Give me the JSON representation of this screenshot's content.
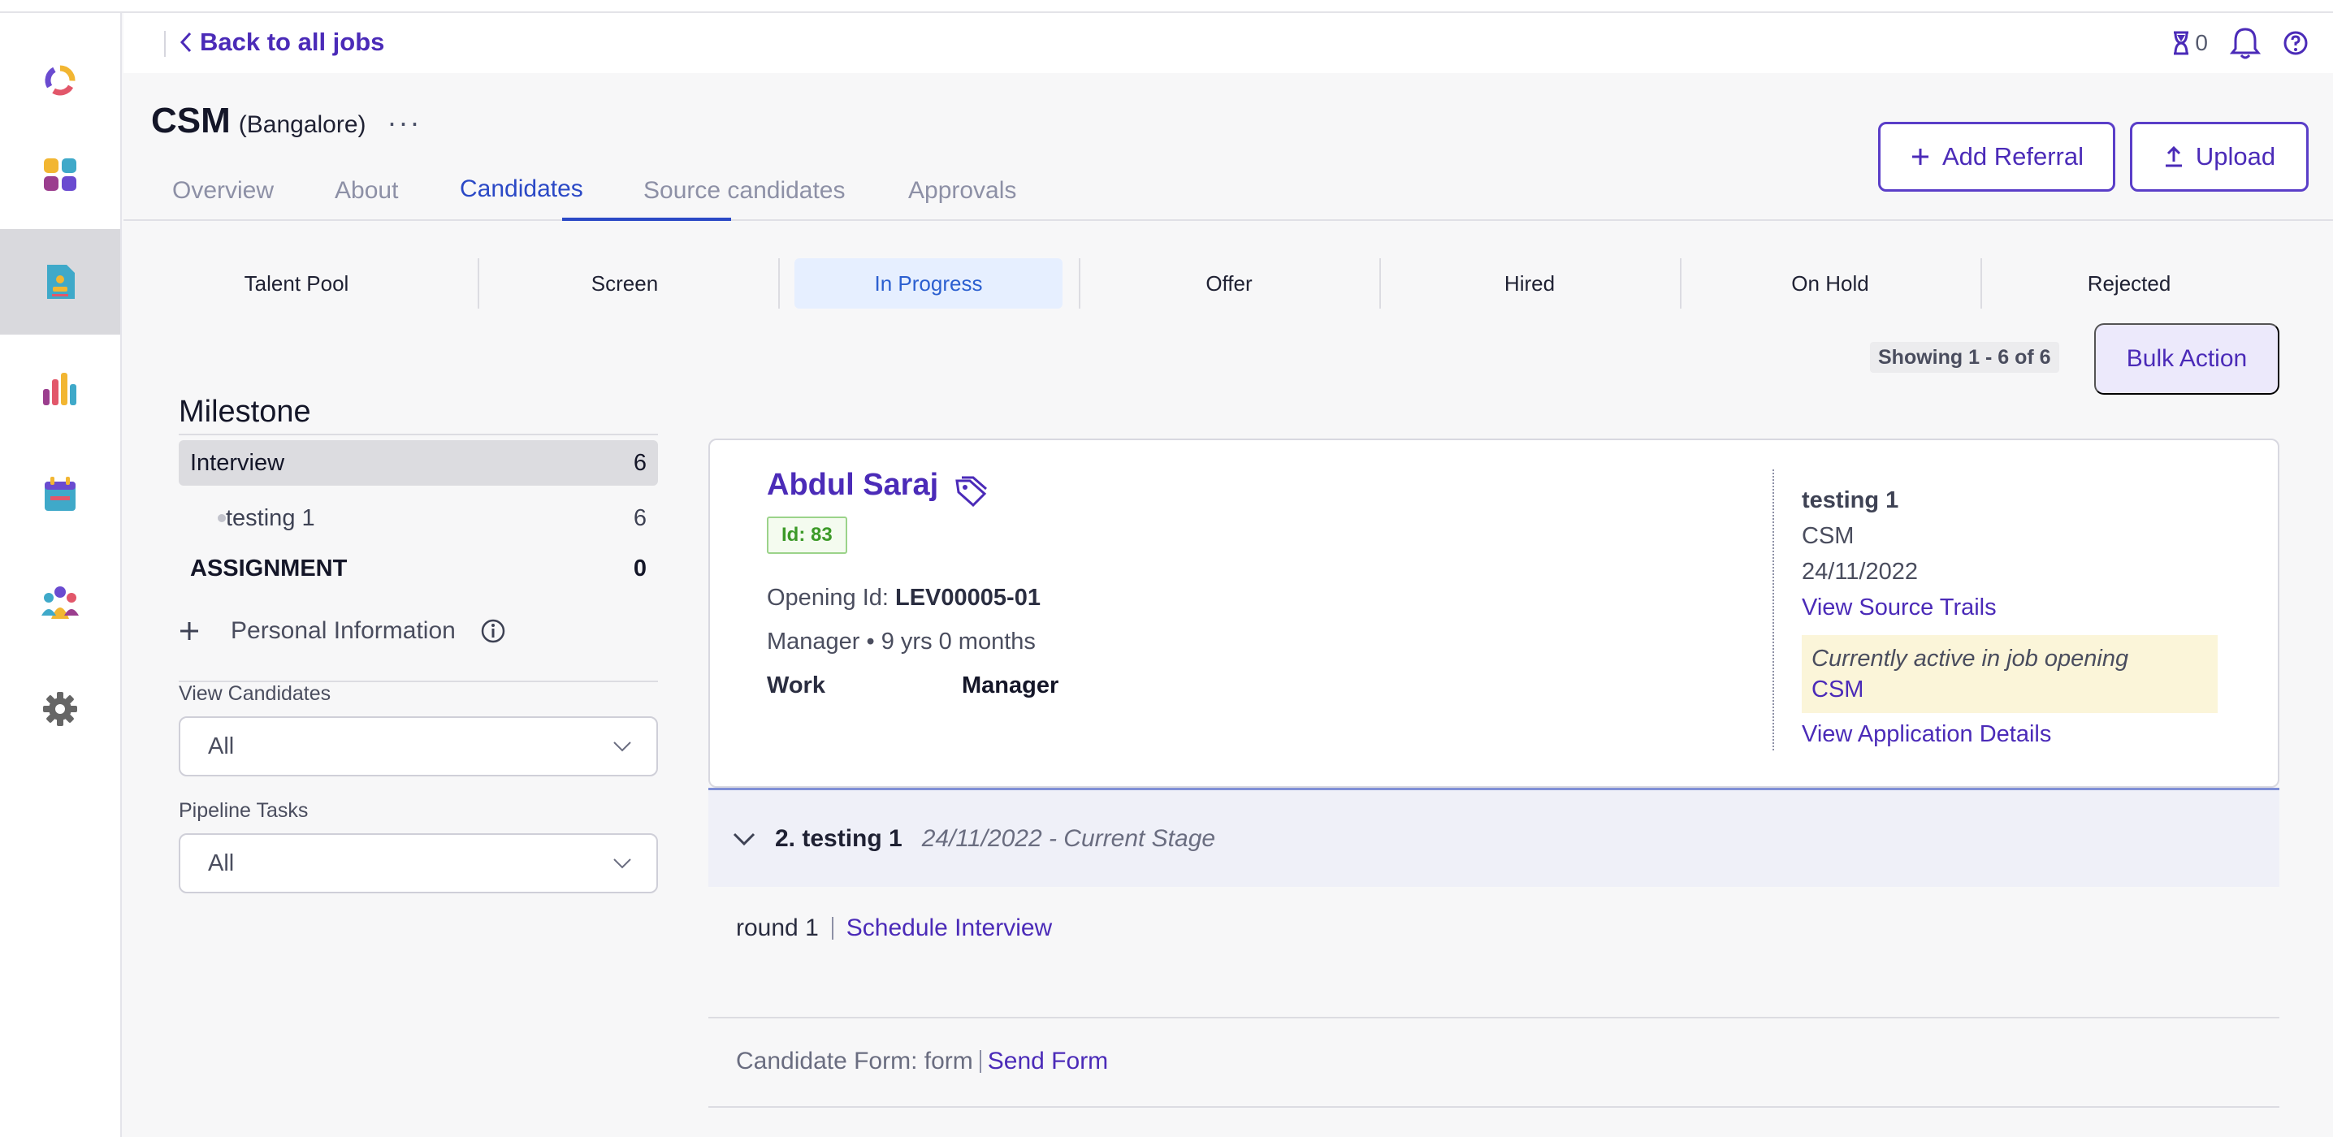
{
  "header": {
    "back_label": "Back to all jobs",
    "timer_count": "0"
  },
  "job": {
    "title": "CSM",
    "location": "(Bangalore)",
    "more": "···"
  },
  "tabs": [
    "Overview",
    "About",
    "Candidates",
    "Source candidates",
    "Approvals"
  ],
  "actions": {
    "add_referral": "Add Referral",
    "upload": "Upload",
    "bulk_action": "Bulk Action"
  },
  "stages": [
    "Talent Pool",
    "Screen",
    "In Progress",
    "Offer",
    "Hired",
    "On Hold",
    "Rejected"
  ],
  "active_stage": "In Progress",
  "showing": "Showing 1 - 6 of 6",
  "milestone": {
    "title": "Milestone",
    "rows": [
      {
        "label": "Interview",
        "count": "6"
      },
      {
        "label": "testing 1",
        "count": "6"
      },
      {
        "label": "ASSIGNMENT",
        "count": "0"
      }
    ]
  },
  "filters": {
    "personal_info": "Personal Information",
    "view_candidates_label": "View Candidates",
    "view_candidates_value": "All",
    "pipeline_tasks_label": "Pipeline Tasks",
    "pipeline_tasks_value": "All"
  },
  "candidate": {
    "name": "Abdul Saraj",
    "id": "Id: 83",
    "opening_label": "Opening Id: ",
    "opening_id": "LEV00005-01",
    "experience": "Manager • 9 yrs 0 months",
    "work_label": "Work",
    "work_value": "Manager",
    "stage_name": "testing 1",
    "job": "CSM",
    "date": "24/11/2022",
    "view_source_trails": "View Source Trails",
    "active_note": "Currently active in job opening",
    "active_job": "CSM",
    "view_application": "View Application Details"
  },
  "stage_detail": {
    "title": "2. testing 1",
    "date": "24/11/2022 - Current Stage",
    "round": "round 1",
    "schedule": "Schedule Interview",
    "form_label": "Candidate Form: form",
    "send_form": "Send Form"
  },
  "icons": {
    "logo": "logo-ring-icon",
    "dashboard": "dashboard-grid-icon",
    "jobs": "job-document-icon",
    "reports": "bar-chart-icon",
    "calendar": "calendar-icon",
    "team": "team-icon",
    "settings": "gear-icon"
  },
  "colors": {
    "accent": "#4b2bb8",
    "active_tab": "#2b49c6",
    "stage_active_bg": "#e6efff"
  }
}
